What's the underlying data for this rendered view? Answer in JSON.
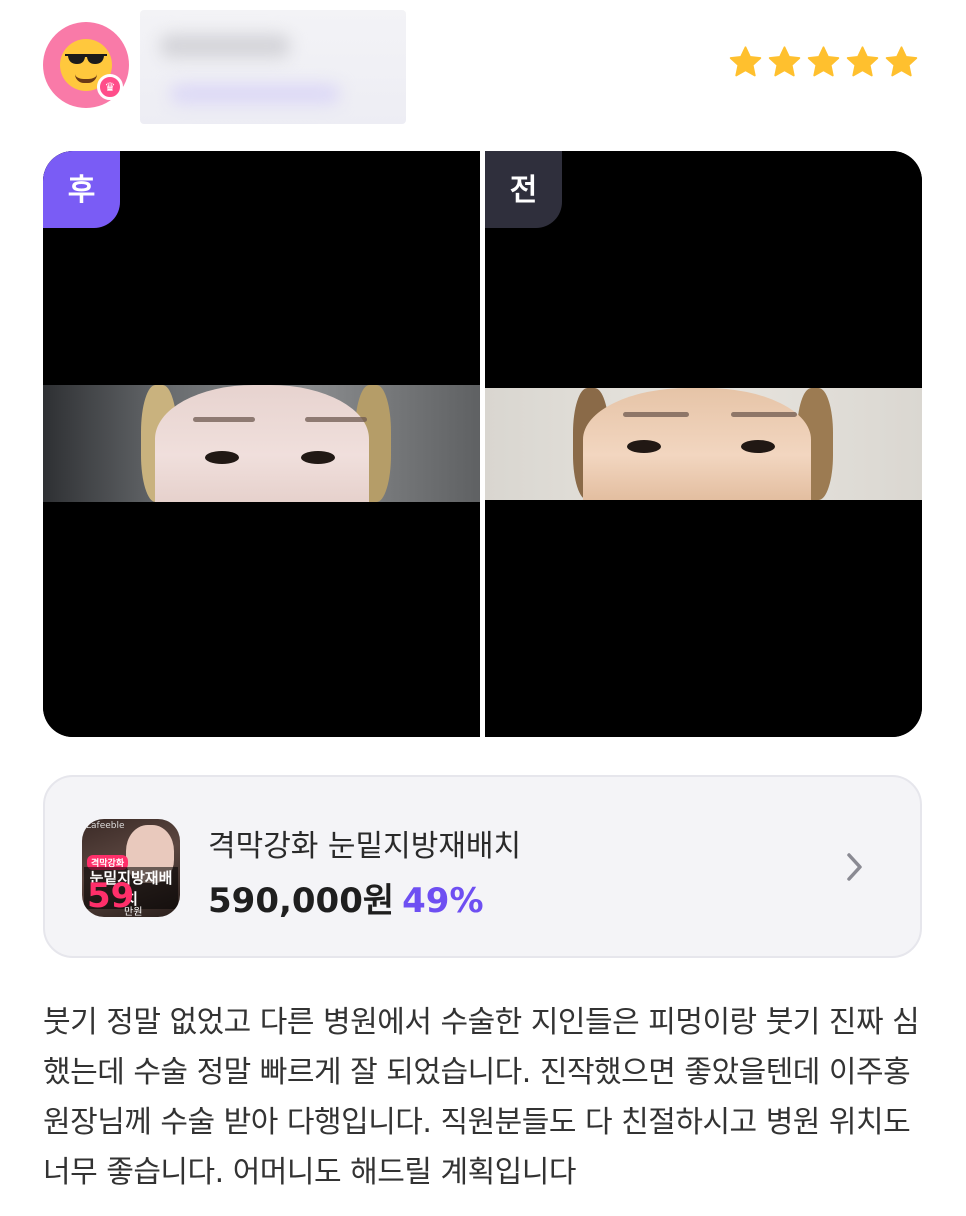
{
  "rating": {
    "stars": 5,
    "max": 5,
    "color": "#ffc02e"
  },
  "icons": {
    "avatar": "sunglasses-emoji-icon",
    "badge": "crown-icon",
    "star": "star-icon",
    "chevron": "chevron-right-icon"
  },
  "photos": {
    "after_label": "후",
    "before_label": "전",
    "after_color": "#7a5cf5",
    "before_color": "#2f2f3c"
  },
  "product": {
    "name": "격막강화 눈밑지방재배치",
    "price": "590,000원",
    "discount": "49%",
    "discount_color": "#6e4ff2",
    "thumbnail": {
      "tag": "격막강화",
      "title": "눈밑지방재배치",
      "price": "59",
      "unit": "만원"
    }
  },
  "review": {
    "text": "붓기 정말 없었고 다른 병원에서 수술한 지인들은 피멍이랑 붓기 진짜 심했는데 수술 정말 빠르게 잘 되었습니다. 진작했으면 좋았을텐데 이주홍원장님께 수술 받아 다행입니다. 직원분들도 다 친절하시고 병원 위치도 너무 좋습니다. 어머니도 해드릴 계획입니다"
  }
}
